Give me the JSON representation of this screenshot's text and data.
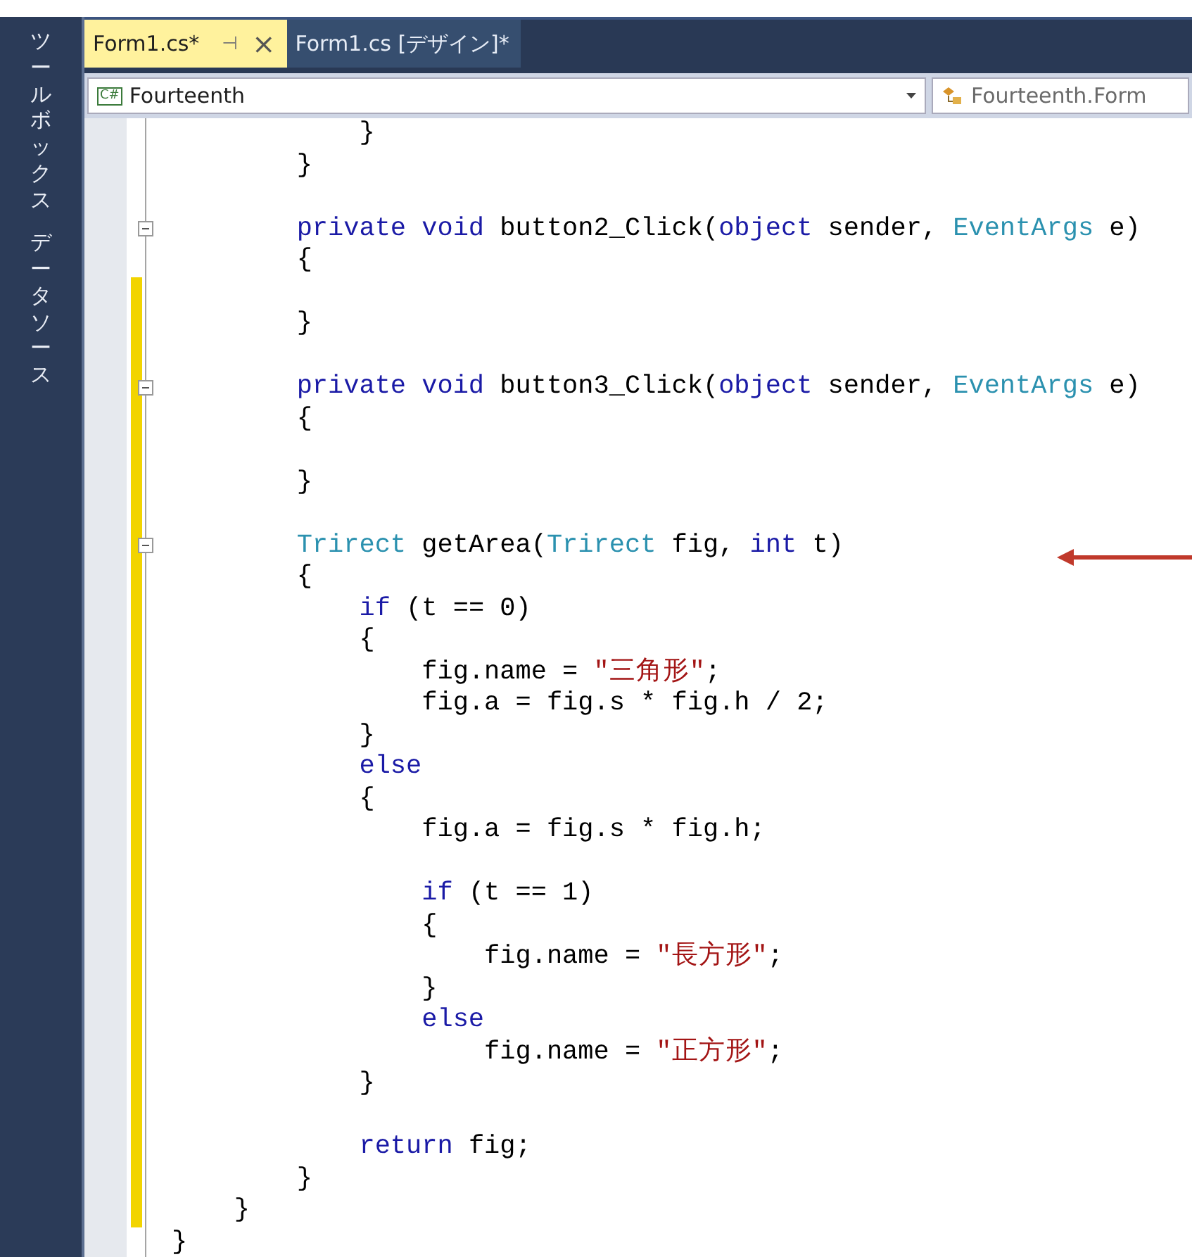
{
  "sidebar": {
    "labels": [
      "ツールボックス",
      "データソース"
    ]
  },
  "tabs": [
    {
      "label": "Form1.cs*",
      "selected": true,
      "pin": "⊣",
      "close": "×"
    },
    {
      "label": "Form1.cs [デザイン]*",
      "selected": false
    }
  ],
  "navigation": {
    "left_icon": "C#",
    "left": "Fourteenth",
    "right": "Fourteenth.Form"
  },
  "code_lines": [
    {
      "tokens": [
        {
          "kind": "plain",
          "text": "            }"
        }
      ],
      "changed": false,
      "fold": false
    },
    {
      "tokens": [
        {
          "kind": "plain",
          "text": "        }"
        }
      ],
      "changed": false,
      "fold": false
    },
    {
      "changed": false,
      "fold": false
    },
    {
      "tokens": [
        {
          "kind": "kw",
          "text": "        private void"
        },
        {
          "kind": "plain",
          "text": " button2_Click("
        },
        {
          "kind": "kw",
          "text": "object"
        },
        {
          "kind": "plain",
          "text": " sender, "
        },
        {
          "kind": "type",
          "text": "EventArgs"
        },
        {
          "kind": "plain",
          "text": " e)"
        }
      ],
      "changed": false,
      "fold": true
    },
    {
      "tokens": [
        {
          "kind": "plain",
          "text": "        {"
        }
      ],
      "changed": false,
      "fold": false
    },
    {
      "changed": true,
      "fold": false
    },
    {
      "tokens": [
        {
          "kind": "plain",
          "text": "        }"
        }
      ],
      "changed": true,
      "fold": false
    },
    {
      "changed": true,
      "fold": false
    },
    {
      "tokens": [
        {
          "kind": "kw",
          "text": "        private void"
        },
        {
          "kind": "plain",
          "text": " button3_Click("
        },
        {
          "kind": "kw",
          "text": "object"
        },
        {
          "kind": "plain",
          "text": " sender, "
        },
        {
          "kind": "type",
          "text": "EventArgs"
        },
        {
          "kind": "plain",
          "text": " e)"
        }
      ],
      "changed": true,
      "fold": true
    },
    {
      "tokens": [
        {
          "kind": "plain",
          "text": "        {"
        }
      ],
      "changed": true,
      "fold": false
    },
    {
      "changed": true,
      "fold": false
    },
    {
      "tokens": [
        {
          "kind": "plain",
          "text": "        }"
        }
      ],
      "changed": true,
      "fold": false
    },
    {
      "changed": true,
      "fold": false
    },
    {
      "tokens": [
        {
          "kind": "type",
          "text": "        Trirect"
        },
        {
          "kind": "plain",
          "text": " getArea("
        },
        {
          "kind": "type",
          "text": "Trirect"
        },
        {
          "kind": "plain",
          "text": " fig, "
        },
        {
          "kind": "kw",
          "text": "int"
        },
        {
          "kind": "plain",
          "text": " t)"
        }
      ],
      "changed": true,
      "fold": true
    },
    {
      "tokens": [
        {
          "kind": "plain",
          "text": "        {"
        }
      ],
      "changed": true,
      "fold": false
    },
    {
      "tokens": [
        {
          "kind": "kw",
          "text": "            if"
        },
        {
          "kind": "plain",
          "text": " (t == 0)"
        }
      ],
      "changed": true,
      "fold": false
    },
    {
      "tokens": [
        {
          "kind": "plain",
          "text": "            {"
        }
      ],
      "changed": true,
      "fold": false
    },
    {
      "tokens": [
        {
          "kind": "plain",
          "text": "                fig.name = "
        },
        {
          "kind": "str",
          "text": "\"三角形\""
        },
        {
          "kind": "plain",
          "text": ";"
        }
      ],
      "changed": true,
      "fold": false
    },
    {
      "tokens": [
        {
          "kind": "plain",
          "text": "                fig.a = fig.s * fig.h / 2;"
        }
      ],
      "changed": true,
      "fold": false
    },
    {
      "tokens": [
        {
          "kind": "plain",
          "text": "            }"
        }
      ],
      "changed": true,
      "fold": false
    },
    {
      "tokens": [
        {
          "kind": "kw",
          "text": "            else"
        }
      ],
      "changed": true,
      "fold": false
    },
    {
      "tokens": [
        {
          "kind": "plain",
          "text": "            {"
        }
      ],
      "changed": true,
      "fold": false
    },
    {
      "tokens": [
        {
          "kind": "plain",
          "text": "                fig.a = fig.s * fig.h;"
        }
      ],
      "changed": true,
      "fold": false
    },
    {
      "changed": true,
      "fold": false
    },
    {
      "tokens": [
        {
          "kind": "kw",
          "text": "                if"
        },
        {
          "kind": "plain",
          "text": " (t == 1)"
        }
      ],
      "changed": true,
      "fold": false
    },
    {
      "tokens": [
        {
          "kind": "plain",
          "text": "                {"
        }
      ],
      "changed": true,
      "fold": false
    },
    {
      "tokens": [
        {
          "kind": "plain",
          "text": "                    fig.name = "
        },
        {
          "kind": "str",
          "text": "\"長方形\""
        },
        {
          "kind": "plain",
          "text": ";"
        }
      ],
      "changed": true,
      "fold": false
    },
    {
      "tokens": [
        {
          "kind": "plain",
          "text": "                }"
        }
      ],
      "changed": true,
      "fold": false
    },
    {
      "tokens": [
        {
          "kind": "kw",
          "text": "                else"
        }
      ],
      "changed": true,
      "fold": false
    },
    {
      "tokens": [
        {
          "kind": "plain",
          "text": "                    fig.name = "
        },
        {
          "kind": "str",
          "text": "\"正方形\""
        },
        {
          "kind": "plain",
          "text": ";"
        }
      ],
      "changed": true,
      "fold": false
    },
    {
      "tokens": [
        {
          "kind": "plain",
          "text": "            }"
        }
      ],
      "changed": true,
      "fold": false
    },
    {
      "changed": true,
      "fold": false
    },
    {
      "tokens": [
        {
          "kind": "kw",
          "text": "            return"
        },
        {
          "kind": "plain",
          "text": " fig;"
        }
      ],
      "changed": true,
      "fold": false
    },
    {
      "tokens": [
        {
          "kind": "plain",
          "text": "        }"
        }
      ],
      "changed": true,
      "fold": false
    },
    {
      "tokens": [
        {
          "kind": "plain",
          "text": "    }"
        }
      ],
      "changed": true,
      "fold": false
    },
    {
      "tokens": [
        {
          "kind": "plain",
          "text": "}"
        }
      ],
      "changed": false,
      "fold": false
    }
  ]
}
